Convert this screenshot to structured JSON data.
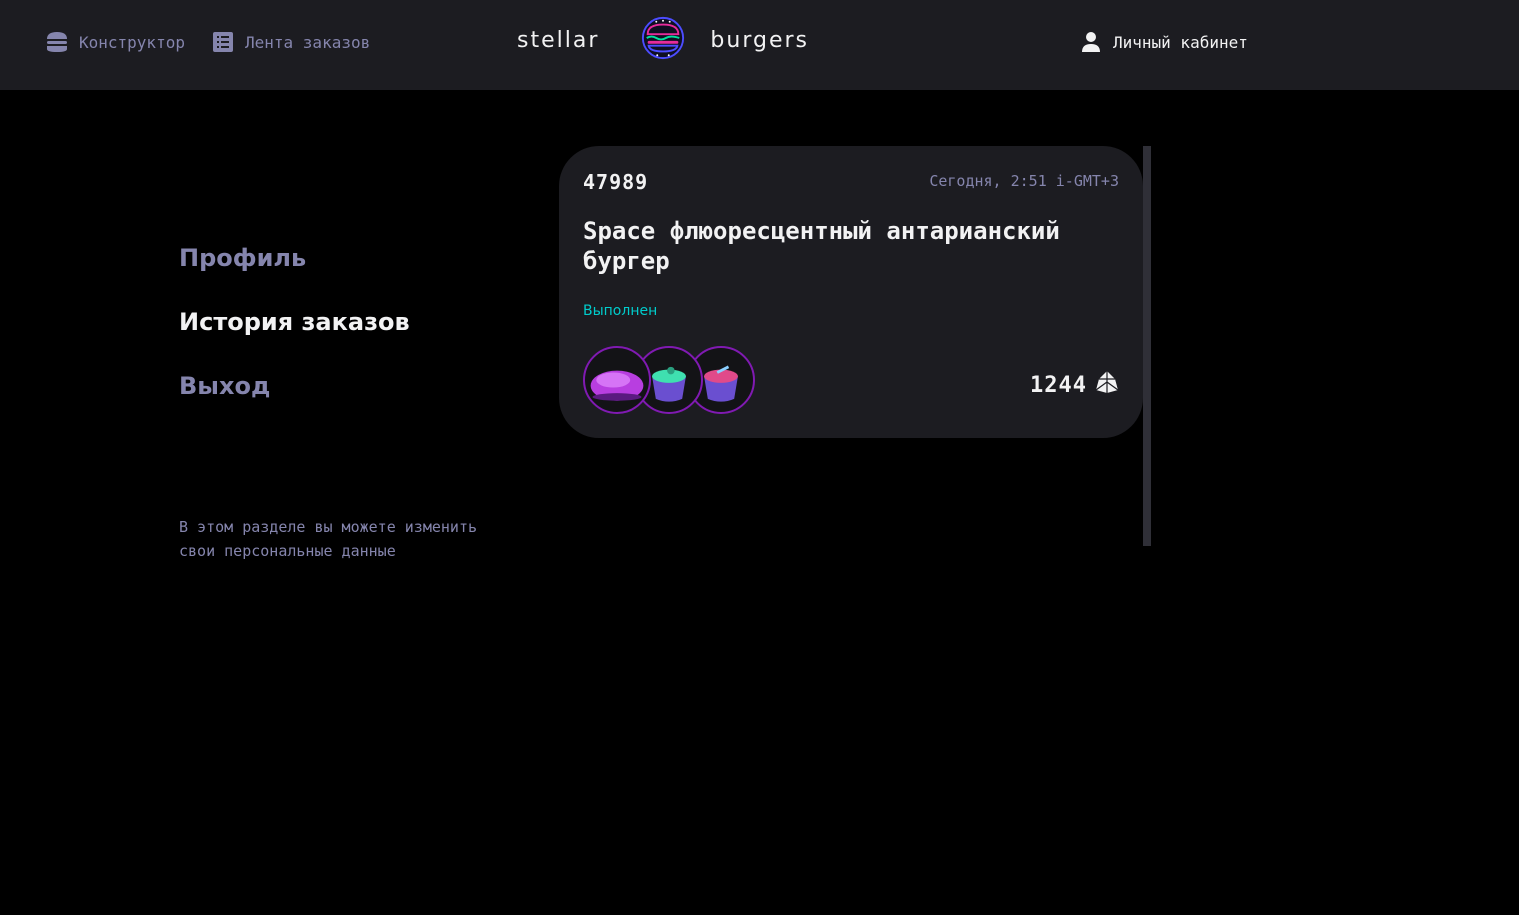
{
  "header": {
    "nav_constructor": "Конструктор",
    "nav_feed": "Лента заказов",
    "logo_left": "stellar",
    "logo_right": "burgers",
    "nav_account": "Личный кабинет"
  },
  "sidebar": {
    "items": [
      {
        "label": "Профиль",
        "active": false
      },
      {
        "label": "История заказов",
        "active": true
      },
      {
        "label": "Выход",
        "active": false
      }
    ],
    "note": "В этом разделе вы можете изменить свои персональные данные"
  },
  "orders": [
    {
      "number": "47989",
      "date": "Сегодня, 2:51 i-GMT+3",
      "name": "Space флюоресцентный антарианский бургер",
      "status": "Выполнен",
      "ingredients": [
        "bun-icon",
        "sauce-icon",
        "sauce-icon"
      ],
      "price": "1244"
    }
  ],
  "colors": {
    "background": "#000000",
    "header": "#1C1C21",
    "card": "#1C1C21",
    "muted": "#8585AD",
    "text": "#F2F2F3",
    "status_done": "#00CCCC",
    "accent": "#801AB2"
  }
}
